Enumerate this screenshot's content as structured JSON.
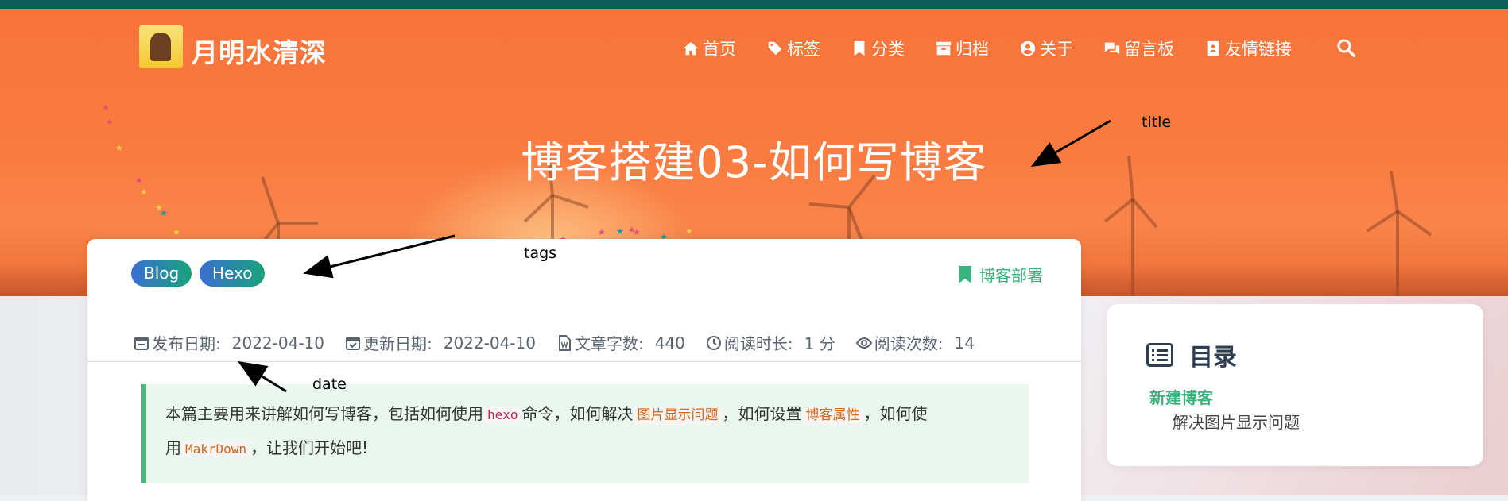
{
  "site": {
    "title": "月明水清深"
  },
  "nav": {
    "items": [
      {
        "label": "首页",
        "icon": "home-icon"
      },
      {
        "label": "标签",
        "icon": "tags-icon"
      },
      {
        "label": "分类",
        "icon": "bookmark-icon"
      },
      {
        "label": "归档",
        "icon": "archive-icon"
      },
      {
        "label": "关于",
        "icon": "user-circle-icon"
      },
      {
        "label": "留言板",
        "icon": "comments-icon"
      },
      {
        "label": "友情链接",
        "icon": "address-book-icon"
      }
    ],
    "search_icon": "search-icon"
  },
  "post": {
    "title": "博客搭建03-如何写博客",
    "tags": [
      "Blog",
      "Hexo"
    ],
    "category": "博客部署",
    "meta": {
      "published_label": "发布日期:",
      "published": "2022-04-10",
      "updated_label": "更新日期:",
      "updated": "2022-04-10",
      "words_label": "文章字数:",
      "words": "440",
      "read_time_label": "阅读时长:",
      "read_time": "1 分",
      "views_label": "阅读次数:",
      "views": "14"
    },
    "intro": {
      "p1": "本篇主要用来讲解如何写博客，包括如何使用",
      "code1": "hexo",
      "p2": "命令，如何解决",
      "hl1": "图片显示问题",
      "p3": "，如何设置",
      "hl2": "博客属性",
      "p4": "，如何使",
      "p5": "用",
      "code2": "MakrDown",
      "p6": "，让我们开始吧!"
    }
  },
  "toc": {
    "title": "目录",
    "items": [
      "新建博客",
      "解决图片显示问题"
    ]
  },
  "annotations": {
    "title": "title",
    "tags": "tags",
    "date": "date"
  },
  "colors": {
    "hero": "#f97a40",
    "accent": "#3bb27d",
    "topbar": "#0f5c5c"
  }
}
